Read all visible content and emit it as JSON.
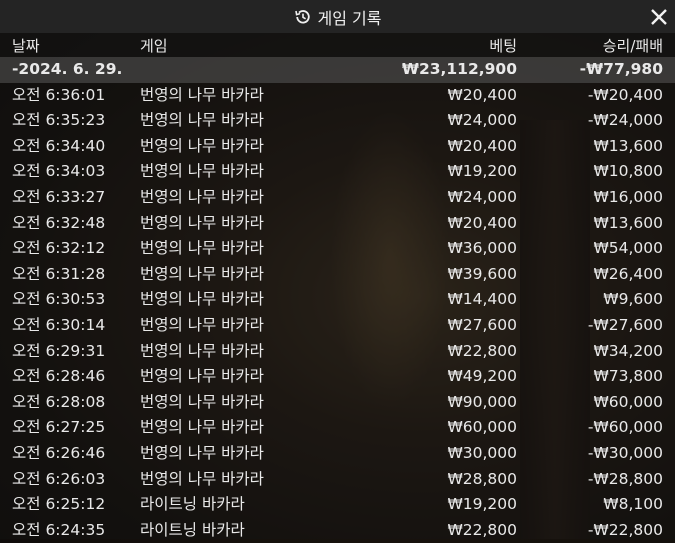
{
  "header": {
    "title": "게임 기록",
    "icon": "history-icon",
    "close_icon": "close-icon"
  },
  "columns": {
    "date": "날짜",
    "game": "게임",
    "bet": "베팅",
    "result": "승리/패배"
  },
  "summary": {
    "date": "-2024. 6. 29.",
    "bet": "₩23,112,900",
    "result": "-₩77,980"
  },
  "rows": [
    {
      "time": "오전 6:36:01",
      "game": "번영의 나무 바카라",
      "bet": "₩20,400",
      "result": "-₩20,400"
    },
    {
      "time": "오전 6:35:23",
      "game": "번영의 나무 바카라",
      "bet": "₩24,000",
      "result": "-₩24,000"
    },
    {
      "time": "오전 6:34:40",
      "game": "번영의 나무 바카라",
      "bet": "₩20,400",
      "result": "₩13,600"
    },
    {
      "time": "오전 6:34:03",
      "game": "번영의 나무 바카라",
      "bet": "₩19,200",
      "result": "₩10,800"
    },
    {
      "time": "오전 6:33:27",
      "game": "번영의 나무 바카라",
      "bet": "₩24,000",
      "result": "₩16,000"
    },
    {
      "time": "오전 6:32:48",
      "game": "번영의 나무 바카라",
      "bet": "₩20,400",
      "result": "₩13,600"
    },
    {
      "time": "오전 6:32:12",
      "game": "번영의 나무 바카라",
      "bet": "₩36,000",
      "result": "₩54,000"
    },
    {
      "time": "오전 6:31:28",
      "game": "번영의 나무 바카라",
      "bet": "₩39,600",
      "result": "₩26,400"
    },
    {
      "time": "오전 6:30:53",
      "game": "번영의 나무 바카라",
      "bet": "₩14,400",
      "result": "₩9,600"
    },
    {
      "time": "오전 6:30:14",
      "game": "번영의 나무 바카라",
      "bet": "₩27,600",
      "result": "-₩27,600"
    },
    {
      "time": "오전 6:29:31",
      "game": "번영의 나무 바카라",
      "bet": "₩22,800",
      "result": "₩34,200"
    },
    {
      "time": "오전 6:28:46",
      "game": "번영의 나무 바카라",
      "bet": "₩49,200",
      "result": "₩73,800"
    },
    {
      "time": "오전 6:28:08",
      "game": "번영의 나무 바카라",
      "bet": "₩90,000",
      "result": "₩60,000"
    },
    {
      "time": "오전 6:27:25",
      "game": "번영의 나무 바카라",
      "bet": "₩60,000",
      "result": "-₩60,000"
    },
    {
      "time": "오전 6:26:46",
      "game": "번영의 나무 바카라",
      "bet": "₩30,000",
      "result": "-₩30,000"
    },
    {
      "time": "오전 6:26:03",
      "game": "번영의 나무 바카라",
      "bet": "₩28,800",
      "result": "-₩28,800"
    },
    {
      "time": "오전 6:25:12",
      "game": "라이트닝 바카라",
      "bet": "₩19,200",
      "result": "₩8,100"
    },
    {
      "time": "오전 6:24:35",
      "game": "라이트닝 바카라",
      "bet": "₩22,800",
      "result": "-₩22,800"
    }
  ]
}
